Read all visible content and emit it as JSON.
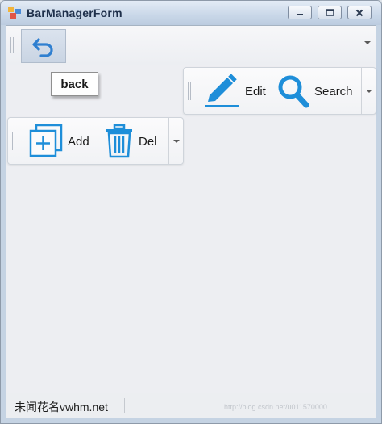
{
  "window": {
    "title": "BarManagerForm",
    "controls": [
      "minimize",
      "maximize",
      "close"
    ]
  },
  "main_bar": {
    "back_button": {
      "icon": "undo-arrow-icon",
      "tooltip": "back"
    }
  },
  "edit_toolbar": {
    "items": [
      {
        "label": "Edit",
        "icon": "pencil-icon"
      },
      {
        "label": "Search",
        "icon": "magnifier-icon"
      }
    ]
  },
  "add_toolbar": {
    "items": [
      {
        "label": "Add",
        "icon": "add-square-icon"
      },
      {
        "label": "Del",
        "icon": "trash-icon"
      }
    ]
  },
  "statusbar": {
    "text": "未闻花名vwhm.net",
    "watermark": "http://blog.csdn.net/u011570000"
  },
  "colors": {
    "icon_blue": "#1e8ed9",
    "title_text": "#1e2f4a"
  }
}
